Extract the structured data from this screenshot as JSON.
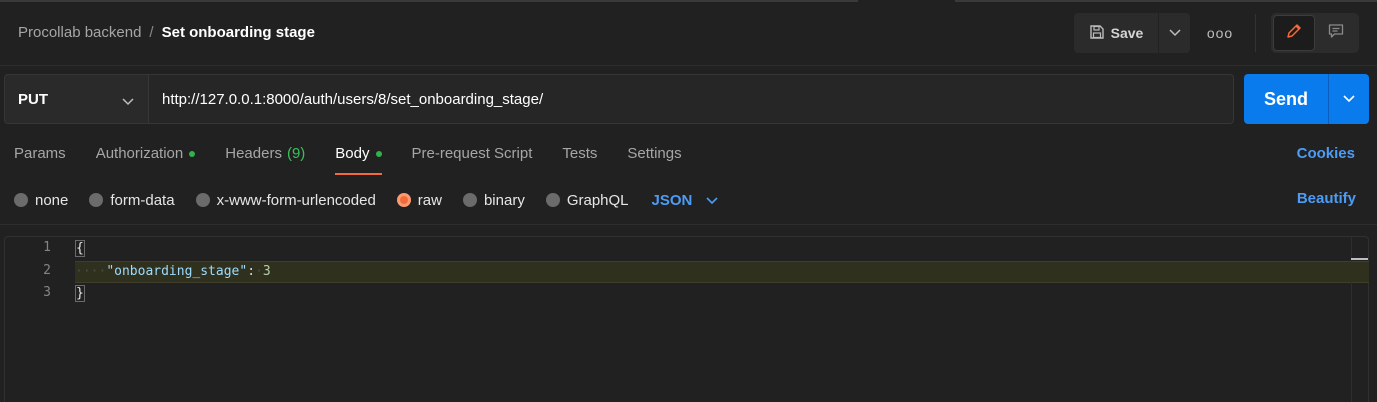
{
  "breadcrumb": {
    "collection": "Procollab backend",
    "separator": "/",
    "request_name": "Set onboarding stage"
  },
  "toolbar": {
    "save_label": "Save",
    "save_icon": "floppy-disk-icon",
    "more_label": "ooo",
    "edit_icon": "pencil-icon",
    "comment_icon": "comment-icon"
  },
  "request": {
    "method": "PUT",
    "url": "http://127.0.0.1:8000/auth/users/8/set_onboarding_stage/",
    "send_label": "Send"
  },
  "tabs": [
    {
      "label": "Params",
      "active": false
    },
    {
      "label": "Authorization",
      "active": false,
      "dot": true
    },
    {
      "label": "Headers",
      "count": "(9)",
      "active": false
    },
    {
      "label": "Body",
      "active": true,
      "dot": true
    },
    {
      "label": "Pre-request Script",
      "active": false
    },
    {
      "label": "Tests",
      "active": false
    },
    {
      "label": "Settings",
      "active": false
    }
  ],
  "cookies_label": "Cookies",
  "body_types": [
    {
      "label": "none",
      "checked": false
    },
    {
      "label": "form-data",
      "checked": false
    },
    {
      "label": "x-www-form-urlencoded",
      "checked": false
    },
    {
      "label": "raw",
      "checked": true
    },
    {
      "label": "binary",
      "checked": false
    },
    {
      "label": "GraphQL",
      "checked": false
    }
  ],
  "raw_format": "JSON",
  "beautify_label": "Beautify",
  "editor": {
    "line_numbers": [
      "1",
      "2",
      "3"
    ],
    "open_brace": "{",
    "key": "\"onboarding_stage\"",
    "colon": ":",
    "value": "3",
    "close_brace": "}"
  },
  "colors": {
    "accent": "#f26b3a",
    "send": "#097bed",
    "link": "#4c9cf6",
    "status_dot": "#2fb34a"
  }
}
